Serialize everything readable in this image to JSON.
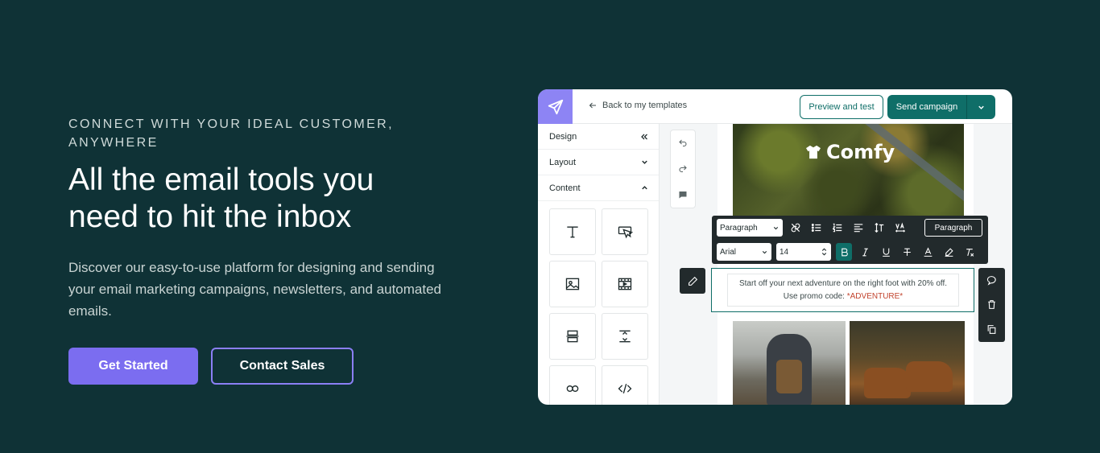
{
  "hero": {
    "eyebrow": "CONNECT WITH YOUR IDEAL CUSTOMER, ANYWHERE",
    "headline": "All the email tools you need to hit the inbox",
    "description": "Discover our easy-to-use platform for designing and sending your email marketing campaigns, newsletters, and automated emails.",
    "primary_cta": "Get Started",
    "secondary_cta": "Contact Sales"
  },
  "editor": {
    "back_label": "Back to my templates",
    "preview_label": "Preview and test",
    "send_label": "Send campaign",
    "sidebar": {
      "design": "Design",
      "layout": "Layout",
      "content": "Content"
    },
    "email": {
      "brand": "Comfy",
      "body_line1": "Start off your next adventure on the right foot with 20% off.",
      "body_line2_prefix": "Use promo code: ",
      "promo_code": "*ADVENTURE*"
    },
    "format_bar": {
      "block_type": "Paragraph",
      "font": "Arial",
      "font_size": "14",
      "style_button": "Paragraph"
    }
  },
  "colors": {
    "background": "#0f3236",
    "accent_purple": "#7b6df0",
    "teal": "#0f6e68"
  }
}
